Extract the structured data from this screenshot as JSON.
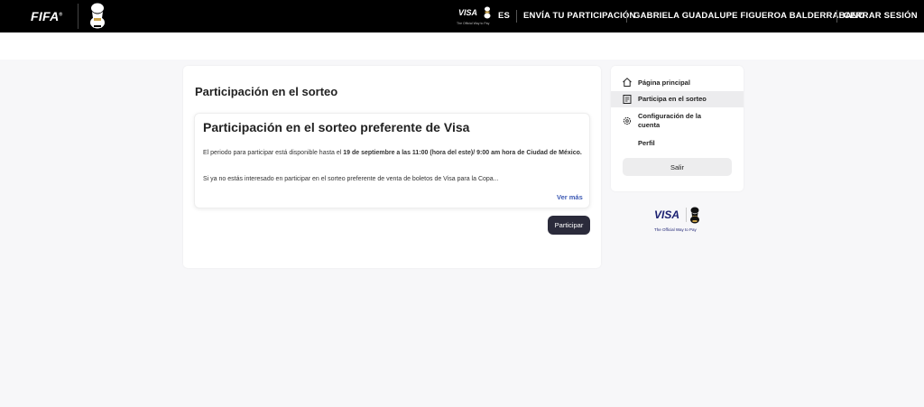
{
  "header": {
    "logo_text": "FIFA",
    "logo_mark": "®",
    "visa_text": "VISA",
    "visa_tagline": "The Official Way to Pay",
    "nav": [
      {
        "label": "ES"
      },
      {
        "label": "ENVÍA TU PARTICIPACIÓN"
      },
      {
        "label": "GABRIELA GUADALUPE FIGUEROA BALDERRABANO"
      },
      {
        "label": "CERRAR SESIÓN"
      }
    ]
  },
  "main": {
    "title": "Participación en el sorteo",
    "card": {
      "title": "Participación en el sorteo preferente de Visa",
      "p1_pre": "El periodo para participar está disponible hasta el ",
      "p1_bold": "19 de septiembre a las 11:00 (hora del este)/ 9:00 am hora de Ciudad de México.",
      "p2": "Si ya no estás interesado en participar en el sorteo preferente de venta de boletos de Visa para la Copa...",
      "more_label": "Ver más"
    },
    "action_label": "Participar"
  },
  "sidebar": {
    "items": [
      {
        "label": "Página principal",
        "icon": "home-icon"
      },
      {
        "label": "Participa en el sorteo",
        "icon": "document-icon",
        "active": true
      },
      {
        "label": "Configuración de la cuenta",
        "icon": "gear-icon"
      },
      {
        "label": "Perfil"
      }
    ],
    "logout_label": "Salir"
  },
  "sponsor": {
    "visa_text": "VISA",
    "tagline": "The Official Way to Pay"
  },
  "colors": {
    "topbar": "#000000",
    "page_bg": "#f7f7f9",
    "link": "#3d5ab4",
    "primary_button": "#2b2b3b",
    "visa_blue": "#1a1f71"
  }
}
